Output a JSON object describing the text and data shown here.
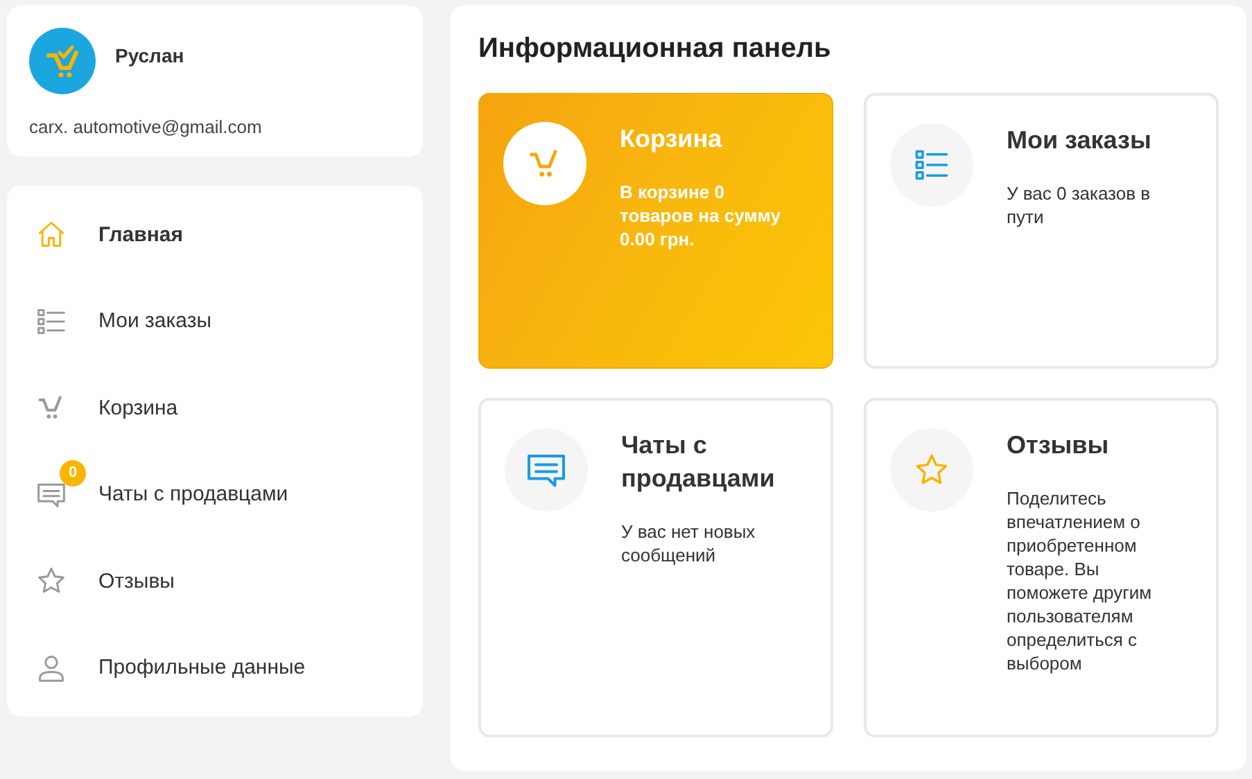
{
  "profile": {
    "name": "Руслан",
    "email": "carx. automotive@gmail.com"
  },
  "nav": [
    {
      "label": "Главная",
      "kind": "home",
      "selected": true
    },
    {
      "label": "Мои заказы",
      "kind": "list",
      "selected": false
    },
    {
      "label": "Корзина",
      "kind": "cart",
      "selected": false
    },
    {
      "label": "Чаты с продавцами",
      "kind": "chat",
      "selected": false,
      "badge": "0"
    },
    {
      "label": "Отзывы",
      "kind": "star",
      "selected": false
    },
    {
      "label": "Профильные данные",
      "kind": "user",
      "selected": false
    }
  ],
  "dashboard": {
    "title": "Информационная панель",
    "cards": [
      {
        "title": "Корзина",
        "text": "В корзине 0 товаров на сумму 0.00 грн.",
        "kind": "cart",
        "highlighted": true
      },
      {
        "title": "Мои заказы",
        "text": "У вас 0 заказов в пути",
        "kind": "list",
        "highlighted": false
      },
      {
        "title": "Чаты с продавцами",
        "text": "У вас нет новых сообщений",
        "kind": "chat",
        "highlighted": false
      },
      {
        "title": "Отзывы",
        "text": "Поделитесь впечатлением о приобретенном товаре. Вы поможете другим пользователям определиться с выбором",
        "kind": "star",
        "highlighted": false
      }
    ]
  }
}
